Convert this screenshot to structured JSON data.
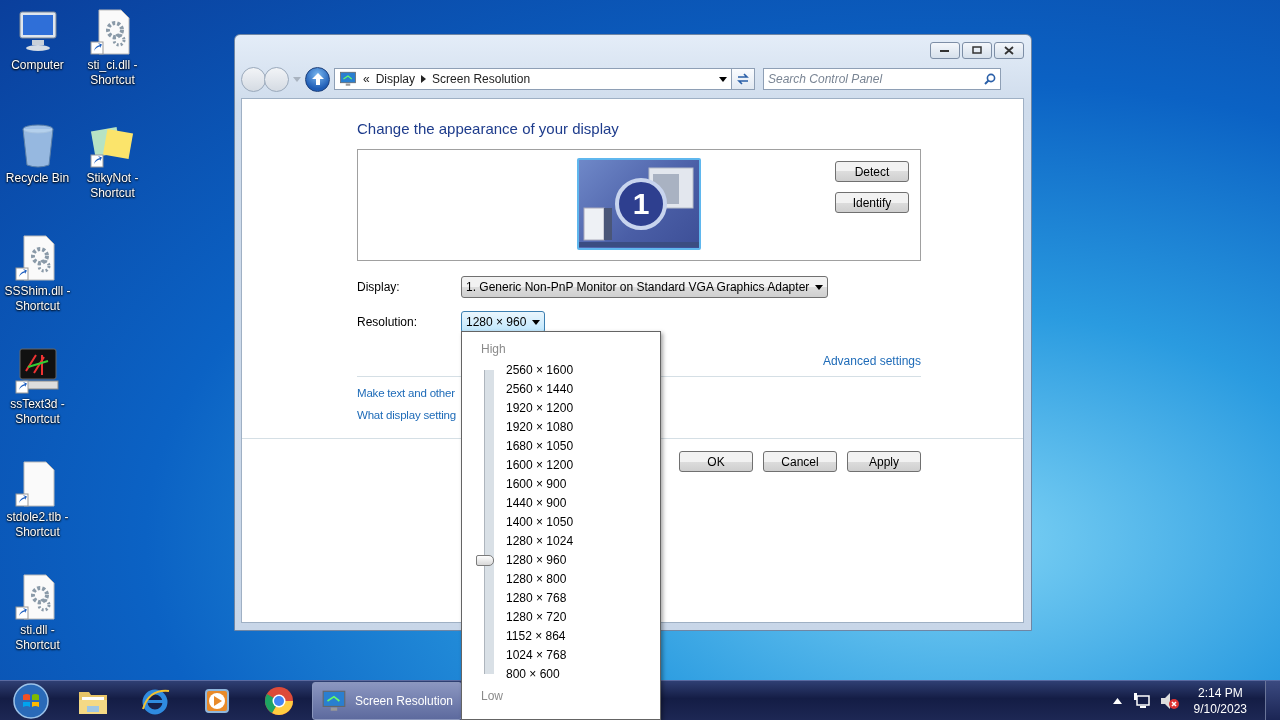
{
  "desktop_icons": [
    {
      "label": "Computer",
      "kind": "computer",
      "shortcut": false
    },
    {
      "label": "Recycle Bin",
      "kind": "recycle",
      "shortcut": false
    },
    {
      "label": "SSShim.dll - Shortcut",
      "kind": "gear-doc",
      "shortcut": true
    },
    {
      "label": "ssText3d - Shortcut",
      "kind": "terminal",
      "shortcut": true
    },
    {
      "label": "stdole2.tlb - Shortcut",
      "kind": "blank-doc",
      "shortcut": true
    },
    {
      "label": "sti.dll - Shortcut",
      "kind": "gear-doc",
      "shortcut": true
    },
    {
      "label": "sti_ci.dll - Shortcut",
      "kind": "gear-doc",
      "shortcut": true
    },
    {
      "label": "StikyNot - Shortcut",
      "kind": "sticky",
      "shortcut": true
    }
  ],
  "window": {
    "address": {
      "overflow": "«",
      "crumbs": [
        "Display",
        "Screen Resolution"
      ]
    },
    "search": {
      "placeholder": "Search Control Panel"
    },
    "heading": "Change the appearance of your display",
    "monitor_number": "1",
    "side_buttons": [
      "Detect",
      "Identify"
    ],
    "display": {
      "label": "Display:",
      "value": "1. Generic Non-PnP Monitor on Standard VGA Graphics Adapter"
    },
    "resolution": {
      "label": "Resolution:",
      "value": "1280 × 960"
    },
    "advanced_link": "Advanced settings",
    "links": [
      "Make text and other",
      "What display setting"
    ],
    "buttons": [
      "OK",
      "Cancel",
      "Apply"
    ]
  },
  "resolution_popup": {
    "high": "High",
    "low": "Low",
    "level": 0.375,
    "options": [
      "2560 × 1600",
      "2560 × 1440",
      "1920 × 1200",
      "1920 × 1080",
      "1680 × 1050",
      "1600 × 1200",
      "1600 × 900",
      "1440 × 900",
      "1400 × 1050",
      "1280 × 1024",
      "1280 × 960",
      "1280 × 800",
      "1280 × 768",
      "1280 × 720",
      "1152 × 864",
      "1024 × 768",
      "800 × 600"
    ]
  },
  "taskbar": {
    "items": [
      {
        "kind": "start"
      },
      {
        "kind": "folder"
      },
      {
        "kind": "browser"
      },
      {
        "kind": "media"
      },
      {
        "kind": "chrome"
      },
      {
        "kind": "window",
        "label": "Screen Resolution"
      }
    ],
    "tray": {
      "volume_muted": true,
      "time": "2:14 PM",
      "date": "9/10/2023"
    }
  }
}
